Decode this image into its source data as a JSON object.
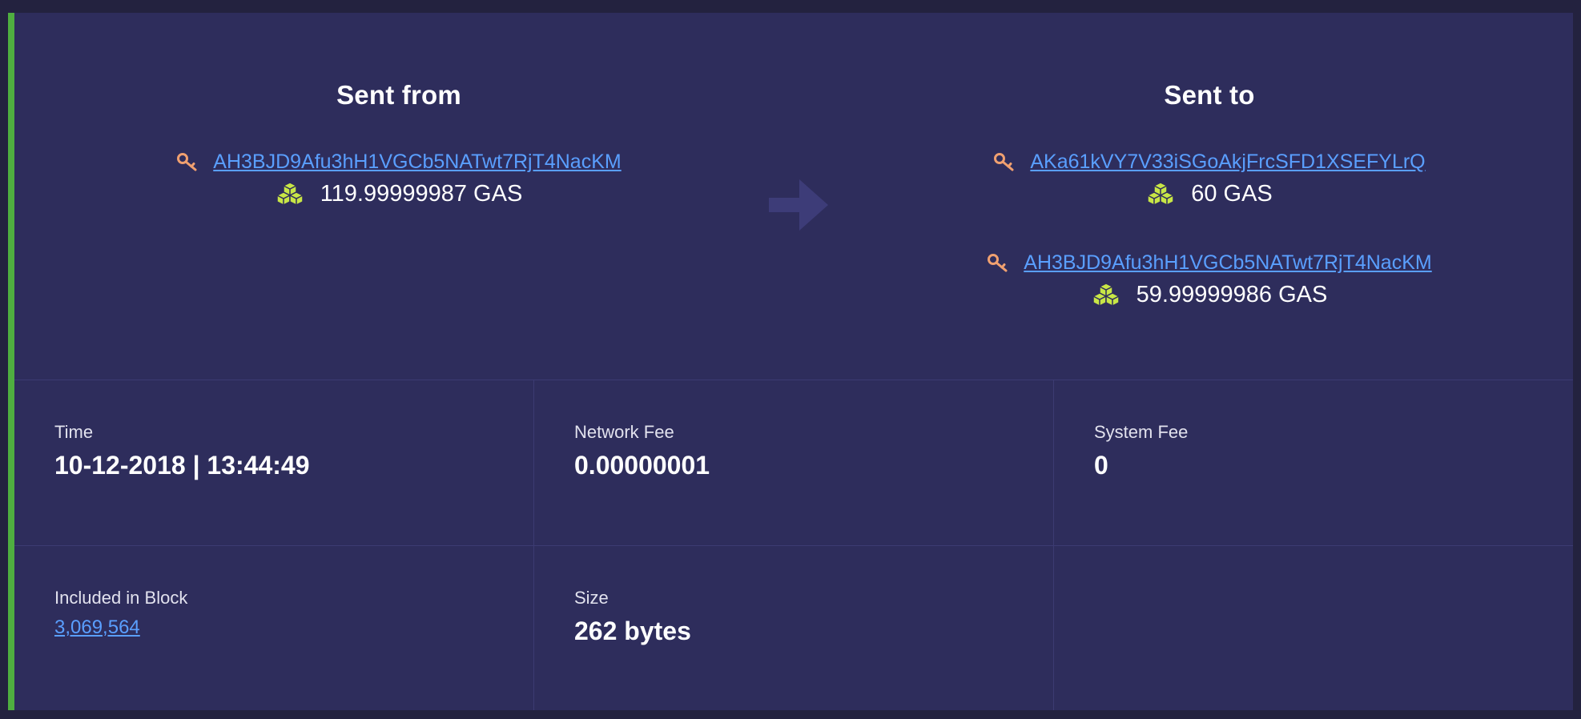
{
  "transfer": {
    "from": {
      "title": "Sent from",
      "entries": [
        {
          "address": "AH3BJD9Afu3hH1VGCb5NATwt7RjT4NacKM",
          "amount": "119.99999987 GAS"
        }
      ]
    },
    "to": {
      "title": "Sent to",
      "entries": [
        {
          "address": "AKa61kVY7V33iSGoAkjFrcSFD1XSEFYLrQ",
          "amount": "60 GAS"
        },
        {
          "address": "AH3BJD9Afu3hH1VGCb5NATwt7RjT4NacKM",
          "amount": "59.99999986 GAS"
        }
      ]
    }
  },
  "details": {
    "time": {
      "label": "Time",
      "value": "10-12-2018 | 13:44:49"
    },
    "network_fee": {
      "label": "Network Fee",
      "value": "0.00000001"
    },
    "system_fee": {
      "label": "System Fee",
      "value": "0"
    },
    "block": {
      "label": "Included in Block",
      "value": "3,069,564"
    },
    "size": {
      "label": "Size",
      "value": "262 bytes"
    }
  },
  "colors": {
    "background": "#23223f",
    "card": "#2e2d5c",
    "accent": "#4fae40",
    "link": "#5a9fff",
    "key_icon": "#f0a070",
    "gas_icon": "#c8e646",
    "arrow": "#3d3c78"
  },
  "icons": {
    "address": "key-icon",
    "amount": "gas-cubes-icon",
    "direction": "arrow-right-icon"
  }
}
